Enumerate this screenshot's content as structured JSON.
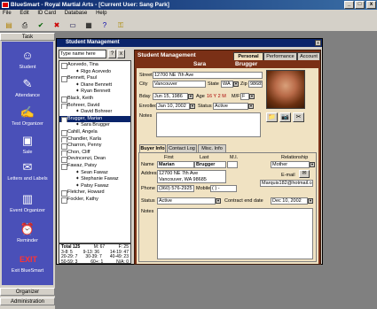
{
  "app": {
    "title": "BlueSmart - Royal Martial Arts - [Current User: Sang Park]"
  },
  "menu": [
    "File",
    "Edit",
    "ID Card",
    "Database",
    "Help"
  ],
  "toolbar_icons": [
    "open-icon",
    "print-icon",
    "check-icon",
    "close-icon",
    "id-card-icon",
    "grid-icon",
    "help-icon",
    "key-icon"
  ],
  "left_panel": {
    "header": "Task",
    "tasks": [
      "Student",
      "Attendance",
      "Test Organizer",
      "Sale",
      "Letters and Labels",
      "Event Organizer",
      "Reminder",
      "Exit BlueSmart"
    ],
    "organizer": "Organizer",
    "administration": "Administration"
  },
  "window": {
    "title": "Student Management",
    "close": "x"
  },
  "search": {
    "placeholder": "Type name here",
    "go": "?",
    "clear": "x"
  },
  "students": [
    {
      "name": "Acevedo, Tina",
      "type": "parent"
    },
    {
      "name": "Rigo Acevedo",
      "type": "child"
    },
    {
      "name": "Bennett, Paul",
      "type": "parent"
    },
    {
      "name": "Diane Bennett",
      "type": "child"
    },
    {
      "name": "Ryan Bennett",
      "type": "child"
    },
    {
      "name": "Black, Keith",
      "type": "parent"
    },
    {
      "name": "Bohreer, David",
      "type": "parent"
    },
    {
      "name": "David Bohreer",
      "type": "child"
    },
    {
      "name": "Brugger, Marian",
      "type": "parent"
    },
    {
      "name": "Sara Brugger",
      "type": "child"
    },
    {
      "name": "Cahill, Angela",
      "type": "parent"
    },
    {
      "name": "Chandler, Karla",
      "type": "parent"
    },
    {
      "name": "Charron, Penny",
      "type": "parent"
    },
    {
      "name": "Chon, Cliff",
      "type": "parent"
    },
    {
      "name": "Devincenzi, Dean",
      "type": "parent"
    },
    {
      "name": "Fawaz, Patsy",
      "type": "parent"
    },
    {
      "name": "Sean Fawaz",
      "type": "child"
    },
    {
      "name": "Stephanie Fawaz",
      "type": "child"
    },
    {
      "name": "Patsy Fawaz",
      "type": "child"
    },
    {
      "name": "Fletcher, Howard",
      "type": "parent"
    },
    {
      "name": "Fockler, Kathy",
      "type": "parent"
    }
  ],
  "totals": {
    "label": "Total",
    "count": "125",
    "m": "M: 67",
    "f": "F: 25",
    "rows": [
      [
        "3-8: 5",
        "9-13: 36",
        "14-19: 47"
      ],
      [
        "20-29: 7",
        "30-39: 7",
        "40-49: 23"
      ],
      [
        "50-59: 3",
        "60+: 1",
        "N/A: 0"
      ]
    ]
  },
  "detail": {
    "header": "Student Management",
    "tabs": [
      "Personal",
      "Performance",
      "Account"
    ],
    "first_name": "Sara",
    "last_name": "Brugger",
    "street_label": "Street",
    "street": "12700 NE 7th Ave",
    "city_label": "City",
    "city": "Vancouver",
    "state_label": "State",
    "state": "WA",
    "zip_label": "Zip",
    "zip": "98685",
    "bday_label": "Bday",
    "bday": "Jun 15, 1986",
    "age_label": "Age",
    "age": "16 Y 2 M",
    "mf_label": "M/F",
    "mf": "F",
    "enrolled_label": "Enrolled",
    "enrolled": "Jan 10, 2002",
    "status_label": "Status",
    "status": "Active",
    "notes_label": "Notes",
    "subtabs": [
      "Buyer Info",
      "Contact Log",
      "Misc. Info"
    ],
    "buyer": {
      "col_first": "First",
      "col_last": "Last",
      "col_mi": "M.I.",
      "col_relationship": "Relationship",
      "name_label": "Name",
      "first": "Marian",
      "last": "Brugger",
      "relationship": "Mother",
      "address_label": "Address",
      "address1": "12700 NE 7th Ave",
      "address2": "Vancouver, WA 98685",
      "email_label": "E-mail",
      "email": "Marquis182@hotmail.com",
      "phone_label": "Phone",
      "phone": "(360) 576-2925",
      "mobile_label": "Mobile",
      "mobile": "( ) -",
      "status_label": "Status",
      "status": "Active",
      "contract_label": "Contract end date",
      "contract": "Dec 10, 2002",
      "notes_label": "Notes"
    }
  }
}
